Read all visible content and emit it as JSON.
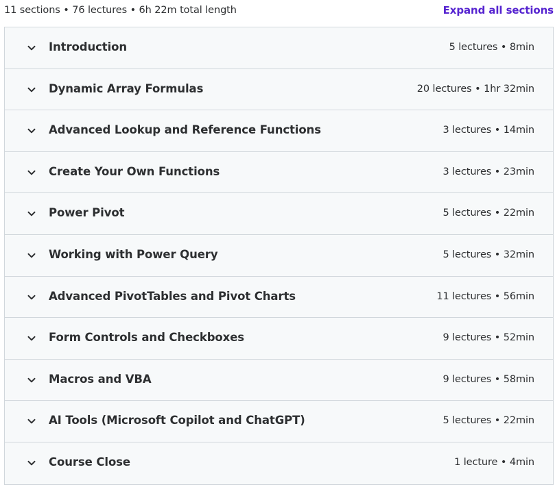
{
  "summary": {
    "text": "11 sections • 76 lectures • 6h 22m total length",
    "expand_label": "Expand all sections"
  },
  "icons": {
    "section_toggle": "chevron-down-icon"
  },
  "colors": {
    "link": "#5624d0",
    "row_bg": "#f7f9fa",
    "border": "#d1d7dc",
    "text": "#2d2f31"
  },
  "sections": [
    {
      "title": "Introduction",
      "meta": "5 lectures • 8min"
    },
    {
      "title": "Dynamic Array Formulas",
      "meta": "20 lectures • 1hr 32min"
    },
    {
      "title": "Advanced Lookup and Reference Functions",
      "meta": "3 lectures • 14min"
    },
    {
      "title": "Create Your Own Functions",
      "meta": "3 lectures • 23min"
    },
    {
      "title": "Power Pivot",
      "meta": "5 lectures • 22min"
    },
    {
      "title": "Working with Power Query",
      "meta": "5 lectures • 32min"
    },
    {
      "title": "Advanced PivotTables and Pivot Charts",
      "meta": "11 lectures • 56min"
    },
    {
      "title": "Form Controls and Checkboxes",
      "meta": "9 lectures • 52min"
    },
    {
      "title": "Macros and VBA",
      "meta": "9 lectures • 58min"
    },
    {
      "title": "AI Tools (Microsoft Copilot and ChatGPT)",
      "meta": "5 lectures • 22min"
    },
    {
      "title": "Course Close",
      "meta": "1 lecture • 4min"
    }
  ]
}
